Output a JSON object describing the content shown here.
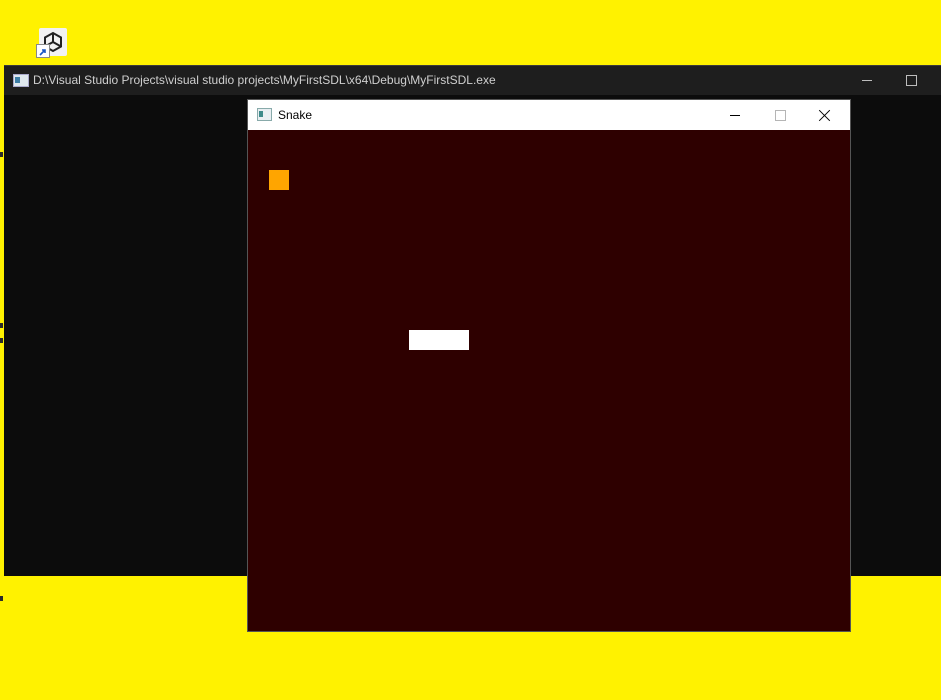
{
  "desktop": {
    "background_color": "#fff200",
    "shortcut_icon": "unity-shortcut-icon"
  },
  "console_window": {
    "title": "D:\\Visual Studio Projects\\visual studio projects\\MyFirstSDL\\x64\\Debug\\MyFirstSDL.exe",
    "icon": "console-app-icon",
    "background_color": "#0c0c0c"
  },
  "snake_window": {
    "title": "Snake",
    "icon": "sdl-app-icon",
    "background_color": "#2e0000",
    "food_color": "#ffa500",
    "snake_color": "#ffffff"
  }
}
